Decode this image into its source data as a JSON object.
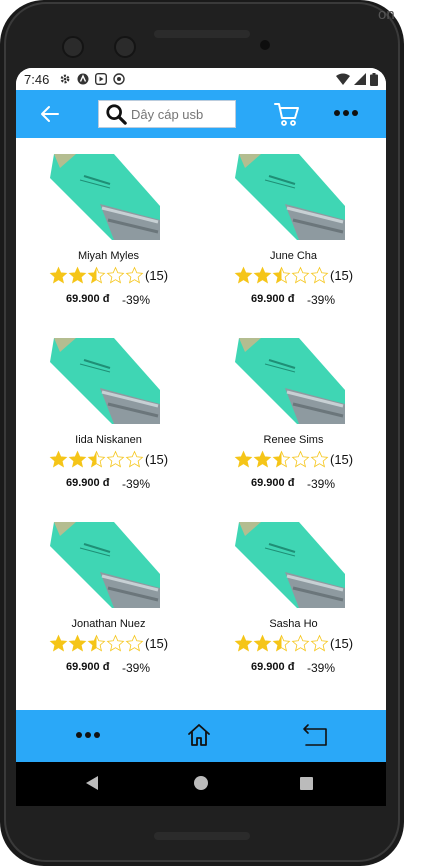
{
  "status_bar": {
    "time": "7:46",
    "left_icons": [
      "gear-icon",
      "vpn-icon",
      "play-icon",
      "sync-icon"
    ],
    "right_icons": [
      "wifi-icon",
      "signal-icon",
      "battery-icon"
    ]
  },
  "side_text": "on",
  "header": {
    "search_placeholder": "Dây cáp usb",
    "icons": [
      "back-arrow-icon",
      "search-icon",
      "cart-icon",
      "more-icon"
    ]
  },
  "products": [
    {
      "name": "Miyah Myles",
      "rating": 2.5,
      "rating_count": "(15)",
      "price": "69.900 đ",
      "discount": "-39%"
    },
    {
      "name": "June Cha",
      "rating": 2.5,
      "rating_count": "(15)",
      "price": "69.900 đ",
      "discount": "-39%"
    },
    {
      "name": "Iida Niskanen",
      "rating": 2.5,
      "rating_count": "(15)",
      "price": "69.900 đ",
      "discount": "-39%"
    },
    {
      "name": "Renee Sims",
      "rating": 2.5,
      "rating_count": "(15)",
      "price": "69.900 đ",
      "discount": "-39%"
    },
    {
      "name": "Jonathan Nuez",
      "rating": 2.5,
      "rating_count": "(15)",
      "price": "69.900 đ",
      "discount": "-39%"
    },
    {
      "name": "Sasha Ho",
      "rating": 2.5,
      "rating_count": "(15)",
      "price": "69.900 đ",
      "discount": "-39%"
    }
  ],
  "bottom_nav": {
    "icons": [
      "more-icon",
      "home-icon",
      "back-icon"
    ]
  },
  "colors": {
    "accent": "#2aa8f8",
    "star": "#f5c518",
    "product": "#3fd6b4"
  }
}
